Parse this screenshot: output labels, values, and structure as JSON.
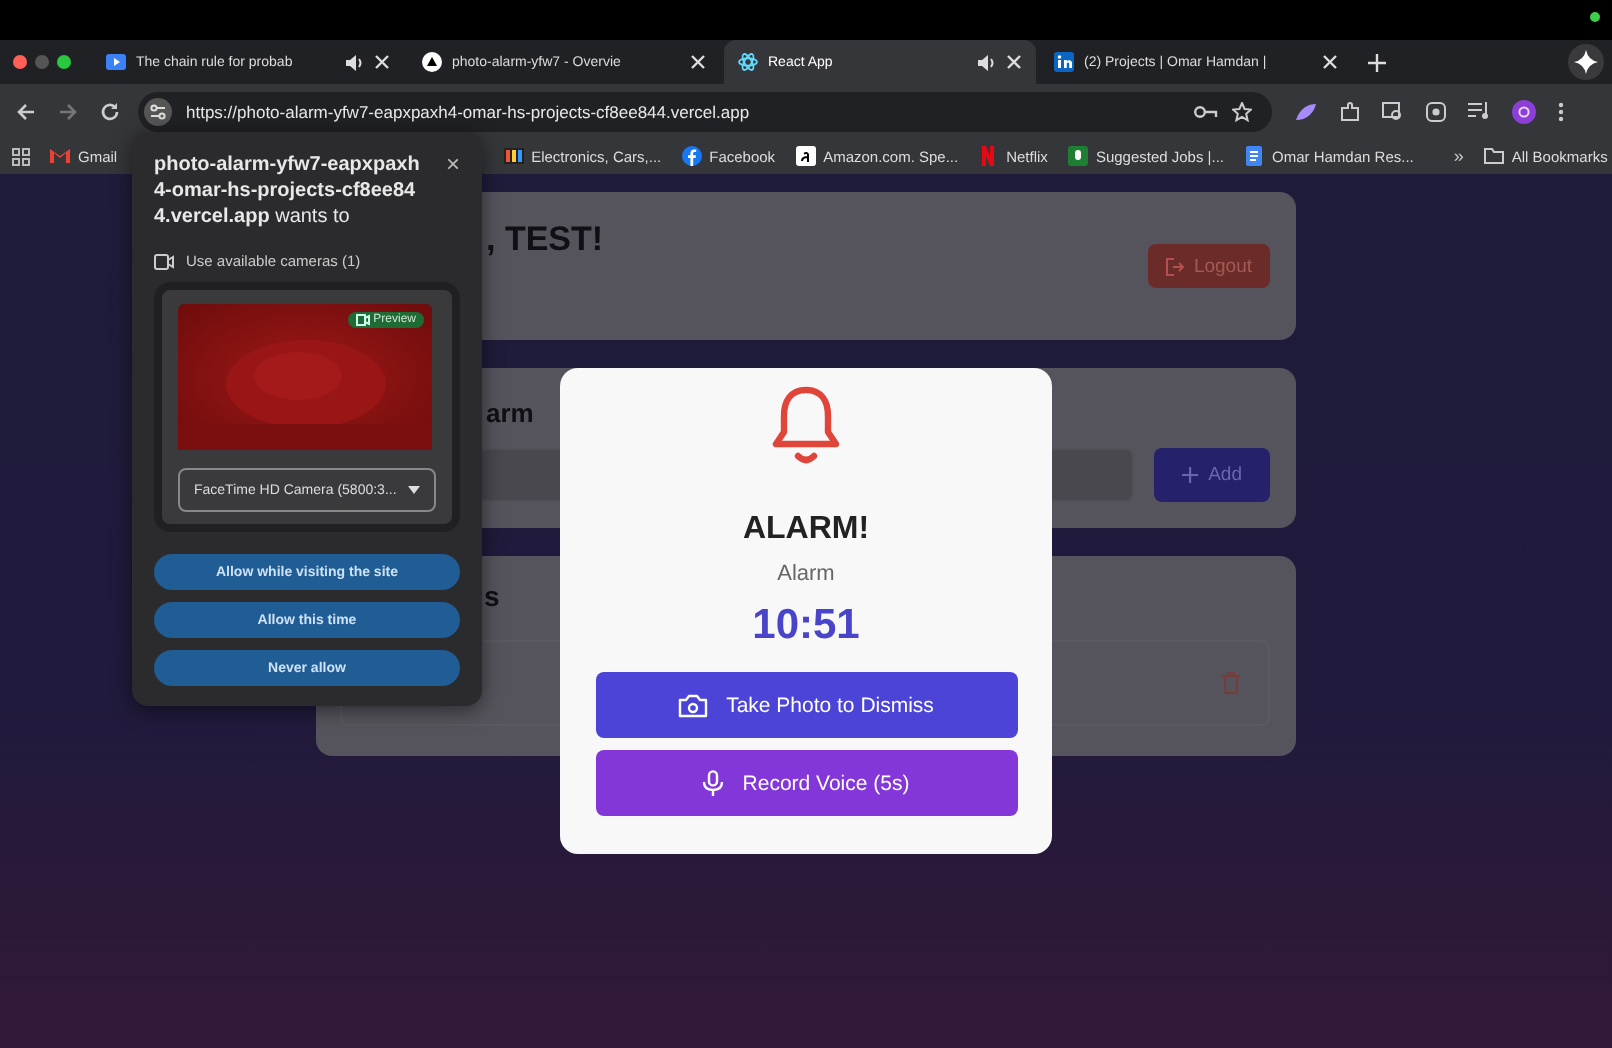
{
  "browser": {
    "tabs": [
      {
        "title": "The chain rule for probab",
        "audio": true,
        "selected": false
      },
      {
        "title": "photo-alarm-yfw7 - Overvie",
        "audio": false,
        "selected": false
      },
      {
        "title": "React App",
        "audio": true,
        "selected": true
      },
      {
        "title": "(2) Projects | Omar Hamdan |",
        "audio": false,
        "selected": false
      }
    ],
    "url": "https://photo-alarm-yfw7-eapxpaxh4-omar-hs-projects-cf8ee844.vercel.app",
    "bookmarks": [
      {
        "label": "Gmail"
      },
      {
        "label": "Electronics, Cars,..."
      },
      {
        "label": "Facebook"
      },
      {
        "label": "Amazon.com. Spe..."
      },
      {
        "label": "Netflix"
      },
      {
        "label": "Suggested Jobs |..."
      },
      {
        "label": "Omar Hamdan Res..."
      }
    ],
    "more": "»",
    "all_bookmarks": "All Bookmarks"
  },
  "permission_prompt": {
    "site": "photo-alarm-yfw7-eapxpaxh4-omar-hs-projects-cf8ee844.vercel.app",
    "wants": "wants to",
    "close": "×",
    "permission": "Use available cameras (1)",
    "preview_badge": "Preview",
    "camera": "FaceTime HD Camera (5800:3...",
    "buttons": [
      "Allow while visiting the site",
      "Allow this time",
      "Never allow"
    ]
  },
  "app": {
    "greeting": ", TEST!",
    "logout": "Logout",
    "add_title": "arm",
    "add_button": "Add",
    "list_title": "s"
  },
  "alarm_modal": {
    "title": "ALARM!",
    "label": "Alarm",
    "time": "10:51",
    "buttons": [
      {
        "label": "Take Photo to Dismiss"
      },
      {
        "label": "Record Voice (5s)",
        "kind": "voice"
      }
    ]
  }
}
